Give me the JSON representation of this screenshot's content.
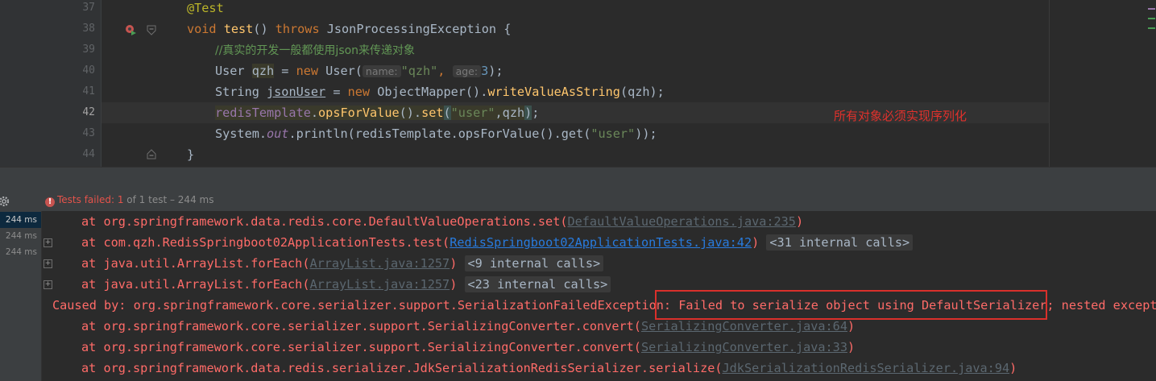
{
  "editor": {
    "line_numbers": [
      "37",
      "38",
      "39",
      "40",
      "41",
      "42",
      "43",
      "44"
    ],
    "code": {
      "l37_annotation": "@Test",
      "l38_void": "void ",
      "l38_name": "test",
      "l38_parens": "() ",
      "l38_throws": "throws ",
      "l38_exc": "JsonProcessingException {",
      "l39_comment": "//真实的开发一般都使用json来传递对象",
      "l40_type": "User ",
      "l40_var": "qzh",
      "l40_eq": " = ",
      "l40_new": "new ",
      "l40_cls": "User(",
      "l40_hint_name": "name:",
      "l40_str": "\"qzh\"",
      "l40_comma": ", ",
      "l40_hint_age": "age:",
      "l40_num": "3",
      "l40_end": ");",
      "l41_type": "String ",
      "l41_var": "jsonUser",
      "l41_eq": " = ",
      "l41_new": "new ",
      "l41_cls": "ObjectMapper().",
      "l41_method": "writeValueAsString",
      "l41_end": "(qzh);",
      "l42_field": "redisTemplate",
      "l42_dot": ".",
      "l42_m1": "opsForValue",
      "l42_p1": "().",
      "l42_m2": "set",
      "l42_open": "(",
      "l42_str": "\"user\"",
      "l42_rest": ",qzh",
      "l42_close": ")",
      "l42_semi": ";",
      "l43_sys": "System.",
      "l43_out": "out",
      "l43_p": ".println(redisTemplate.opsForValue().get(",
      "l43_str": "\"user\"",
      "l43_end": "));",
      "l44_brace": "}"
    },
    "note": "所有对象必须实现序列化"
  },
  "run": {
    "status_prefix": "Tests failed:",
    "status_count": "1",
    "status_suffix": "of 1 test – 244 ms"
  },
  "tree": {
    "times": [
      "244 ms",
      "244 ms",
      "244 ms"
    ]
  },
  "console": {
    "at": "at ",
    "l1_text": "org.springframework.data.redis.core.DefaultValueOperations.set(",
    "l1_link": "DefaultValueOperations.java:235",
    "l1_end": ")",
    "l2_text": "com.qzh.RedisSpringboot02ApplicationTests.test(",
    "l2_link": "RedisSpringboot02ApplicationTests.java:42",
    "l2_end": ")",
    "l2_internal": "<31 internal calls>",
    "l3_text": "java.util.ArrayList.forEach(",
    "l3_link": "ArrayList.java:1257",
    "l3_end": ")",
    "l3_internal": "<9 internal calls>",
    "l4_text": "java.util.ArrayList.forEach(",
    "l4_link": "ArrayList.java:1257",
    "l4_end": ")",
    "l4_internal": "<23 internal calls>",
    "l5_text": "Caused by: org.springframework.core.serializer.support.SerializationFailedException: Failed to serialize object using DefaultSerializer; nested exception",
    "l6_text": "org.springframework.core.serializer.support.SerializingConverter.convert(",
    "l6_link": "SerializingConverter.java:64",
    "l6_end": ")",
    "l7_text": "org.springframework.core.serializer.support.SerializingConverter.convert(",
    "l7_link": "SerializingConverter.java:33",
    "l7_end": ")",
    "l8_text": "org.springframework.data.redis.serializer.JdkSerializationRedisSerializer.serialize(",
    "l8_link": "JdkSerializationRedisSerializer.java:94",
    "l8_end": ")"
  },
  "colors": {
    "background": "#2b2b2b",
    "error_text": "#ff6b68",
    "link": "#287bde",
    "highlight_box": "#d9302b"
  },
  "icons": [
    "run-test-icon",
    "breakpoint-icon",
    "fold-icon",
    "settings-icon",
    "error-icon",
    "expand-icon"
  ]
}
